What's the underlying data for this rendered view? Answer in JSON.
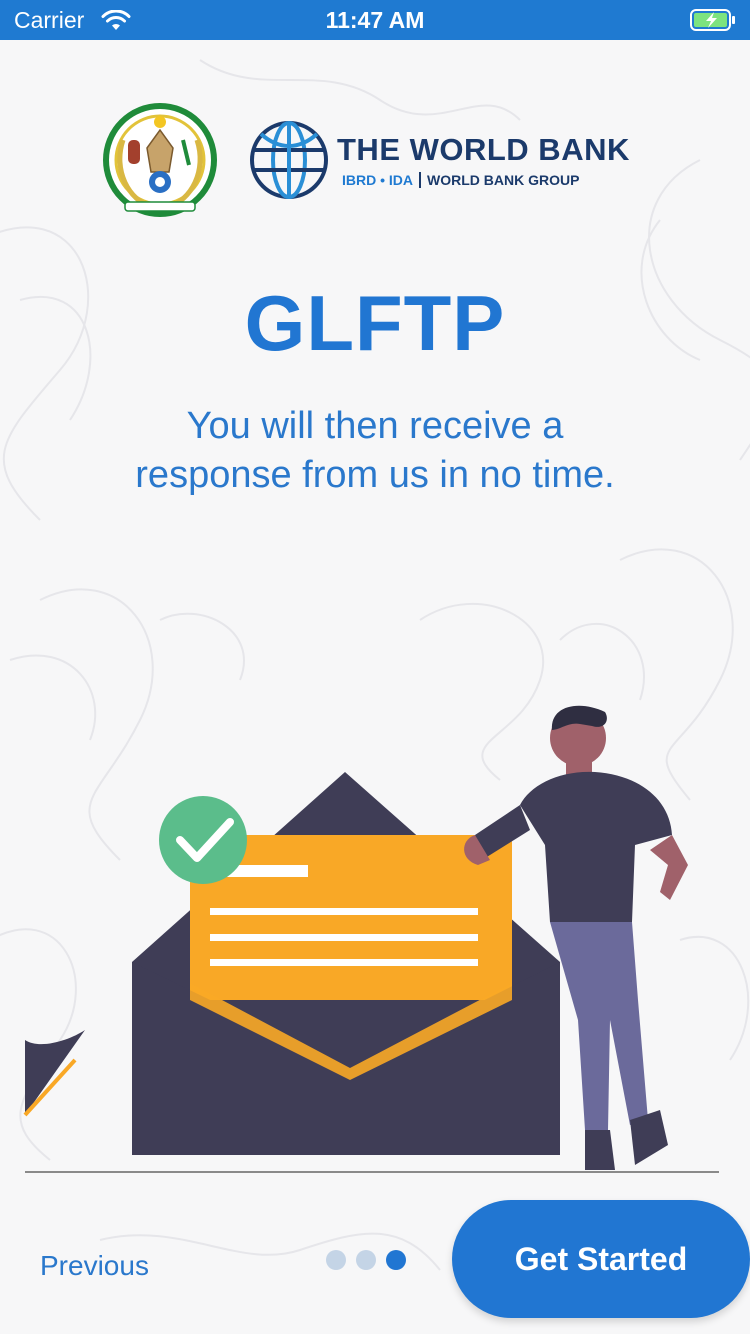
{
  "status_bar": {
    "carrier": "Carrier",
    "time": "11:47 AM",
    "wifi_icon": "wifi-icon",
    "battery_icon": "battery-charging-icon"
  },
  "logos": {
    "emblem": "rwanda-coat-of-arms",
    "world_bank_name": "THE WORLD BANK",
    "world_bank_ibrd": "IBRD • IDA",
    "world_bank_group": "WORLD BANK GROUP"
  },
  "title": "GLFTP",
  "subtitle": "You will then receive a response from us in no time.",
  "pager": {
    "total": 3,
    "current": 3
  },
  "actions": {
    "previous_label": "Previous",
    "get_started_label": "Get Started"
  },
  "colors": {
    "primary": "#2176d2",
    "status_bar": "#1f7ad1",
    "envelope": "#3f3d56",
    "letter": "#f9a826",
    "check": "#5bbd8b",
    "background": "#f7f7f8"
  }
}
